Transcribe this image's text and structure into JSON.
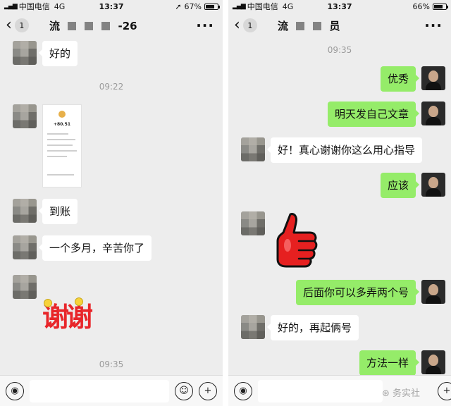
{
  "status": {
    "carrier": "中国电信",
    "network": "4G",
    "time": "13:37",
    "left_battery": "67%",
    "right_battery": "66%",
    "left_battery_level": 0.67,
    "right_battery_level": 0.66
  },
  "left_chat": {
    "unread": "1",
    "title_prefix": "流",
    "title_suffix": "-26",
    "messages": {
      "m1": "好的",
      "t1": "09:22",
      "img_amount": "+80.51",
      "m3": "到账",
      "m4": "一个多月，辛苦你了",
      "sticker": "谢谢",
      "t2": "09:35"
    }
  },
  "right_chat": {
    "unread": "1",
    "title_prefix": "流",
    "title_suffix": "员",
    "messages": {
      "t1": "09:35",
      "o1": "优秀",
      "o2": "明天发自己文章",
      "i1": "好！真心谢谢你这么用心指导",
      "o3": "应该",
      "o4": "后面你可以多弄两个号",
      "i2": "好的，再起俩号",
      "o5": "方法一样"
    },
    "watermark": "⊛ 务实社"
  },
  "icons": {
    "back": "chevron-left-icon",
    "more": "more-icon",
    "voice": "voice-icon",
    "emoji": "emoji-icon",
    "plus": "plus-icon"
  },
  "colors": {
    "outgoing_bubble": "#95ec69",
    "incoming_bubble": "#ffffff",
    "background": "#ededed"
  }
}
